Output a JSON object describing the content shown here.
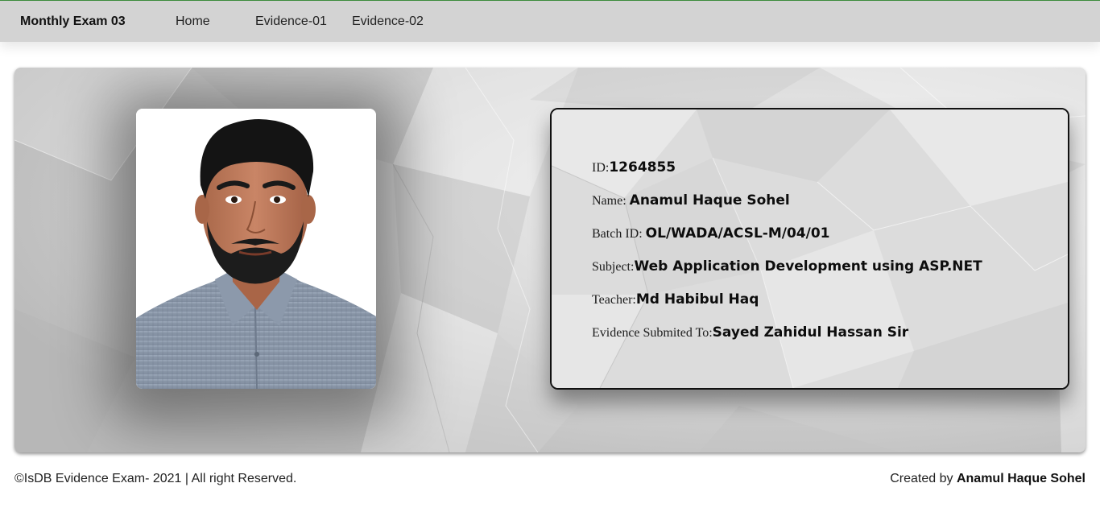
{
  "navbar": {
    "brand": "Monthly Exam 03",
    "links": [
      "Home",
      "Evidence-01",
      "Evidence-02"
    ]
  },
  "profile": {
    "photo_alt": "Student photo",
    "fields": [
      {
        "label": "ID:",
        "value": "1264855"
      },
      {
        "label": "Name: ",
        "value": "Anamul Haque Sohel"
      },
      {
        "label": "Batch ID: ",
        "value": "OL/WADA/ACSL-M/04/01"
      },
      {
        "label": "Subject:",
        "value": "Web Application Development using ASP.NET"
      },
      {
        "label": "Teacher:",
        "value": "Md Habibul Haq"
      },
      {
        "label": "Evidence Submited To:",
        "value": "Sayed Zahidul Hassan Sir"
      }
    ]
  },
  "footer": {
    "copyright": "©IsDB Evidence Exam- 2021 | All right Reserved.",
    "created_prefix": "Created by ",
    "created_name": "Anamul Haque Sohel"
  },
  "colors": {
    "navbar_bg": "#d3d3d3",
    "top_accent": "#3e8e3e",
    "card_bg": "#d8d8d8"
  }
}
